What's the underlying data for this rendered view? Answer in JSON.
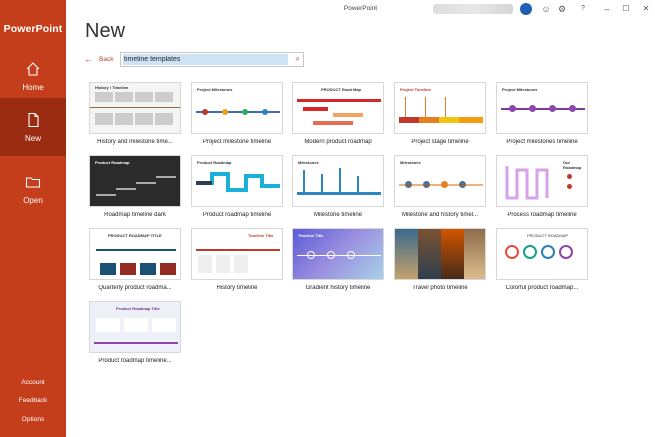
{
  "window": {
    "title": "PowerPoint"
  },
  "sidebar": {
    "app_title": "PowerPoint",
    "items": [
      {
        "label": "Home",
        "icon": "home-icon"
      },
      {
        "label": "New",
        "icon": "new-file-icon"
      },
      {
        "label": "Open",
        "icon": "folder-icon"
      }
    ],
    "bottom": [
      "Account",
      "Feedback",
      "Options"
    ]
  },
  "main": {
    "title": "New",
    "back_label": "Back",
    "search_value": "timeline templates"
  },
  "templates": [
    {
      "label": "History and milestone time..."
    },
    {
      "label": "Project milestone timeline"
    },
    {
      "label": "Modern product roadmap"
    },
    {
      "label": "Project stage timeline"
    },
    {
      "label": "Project milestones timeline"
    },
    {
      "label": "Roadmap timeline dark"
    },
    {
      "label": "Product roadmap timeline"
    },
    {
      "label": "Milestone timeline"
    },
    {
      "label": "Milestone and history timel..."
    },
    {
      "label": "Process roadmap timeline"
    },
    {
      "label": "Quarterly product roadma..."
    },
    {
      "label": "History timeline"
    },
    {
      "label": "Gradient history timeline"
    },
    {
      "label": "Travel photo timeline"
    },
    {
      "label": "Colorful product roadmap..."
    },
    {
      "label": "Product roadmap timeline..."
    }
  ],
  "thumb_text": {
    "t1": "History / Timeline",
    "t2": "Project Milestones",
    "t3": "PRODUCT Road Map",
    "t4": "Project Timeline",
    "t5": "Project Milestones",
    "t6": "Product Roadmap",
    "t7": "Product Roadmap",
    "t8": "Milestones",
    "t9": "Milestones",
    "t10": "Our Roadmap",
    "t11": "PRODUCT ROADMAP TITLE",
    "t12": "Timeline Title",
    "t13": "Timeline Title",
    "t15": "PRODUCT ROADMAP",
    "t16": "Product Roadmap Title"
  },
  "colors": {
    "accent": "#c43e1c",
    "accent_dark": "#9b2c11"
  }
}
